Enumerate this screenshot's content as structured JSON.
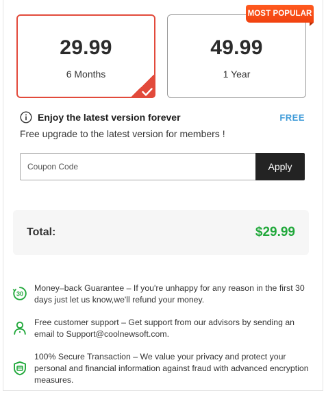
{
  "badge": {
    "label": "MOST POPULAR"
  },
  "plans": [
    {
      "price": "29.99",
      "term": "6 Months",
      "selected": true
    },
    {
      "price": "49.99",
      "term": "1 Year",
      "selected": false
    }
  ],
  "upgrade": {
    "icon": "info-icon",
    "title": "Enjoy the latest version forever",
    "price_label": "FREE",
    "description": "Free upgrade to the latest version for members !"
  },
  "coupon": {
    "placeholder": "Coupon Code",
    "value": "",
    "apply_label": "Apply"
  },
  "total": {
    "label": "Total:",
    "value": "$29.99"
  },
  "guarantees": [
    {
      "icon": "30-day-badge-icon",
      "text": "Money–back Guarantee – If you're unhappy for any reason in the first 30 days just let us know,we'll refund your money."
    },
    {
      "icon": "user-support-icon",
      "text": "Free customer support – Get support from our advisors by sending an email to Support@coolnewsoft.com."
    },
    {
      "icon": "secure-shield-icon",
      "text": "100% Secure Transaction – We value your privacy and protect your personal and financial information against fraud with advanced encryption measures."
    }
  ],
  "colors": {
    "selected_border": "#e24a3b",
    "badge": "#f1420f",
    "free_label": "#3d9ad8",
    "total_value": "#21a83b",
    "icon_green": "#21a83b",
    "apply_button": "#232323"
  }
}
